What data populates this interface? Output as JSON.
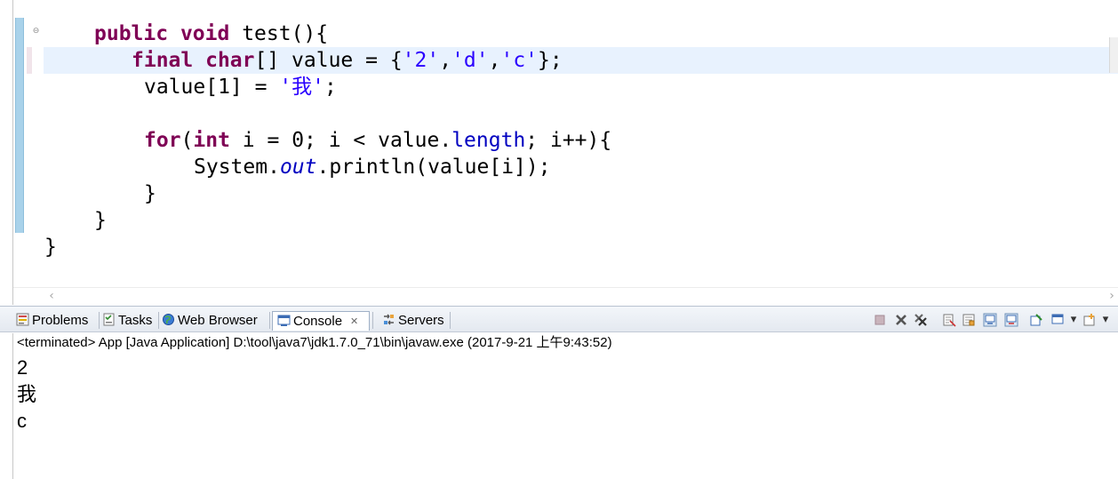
{
  "editor": {
    "code": {
      "line1": {
        "kw_public": "public",
        "kw_void": "void",
        "rest": " test(){"
      },
      "line2": {
        "kw_final": "final",
        "kw_char": "char",
        "mid": "[] value = {",
        "s1": "'2'",
        "c1": ",",
        "s2": "'d'",
        "c2": ",",
        "s3": "'c'",
        "end": "};"
      },
      "line3": {
        "start": "value[1] = ",
        "s1": "'我'",
        "end": ";"
      },
      "line4": {
        "kw_for": "for",
        "p1": "(",
        "kw_int": "int",
        "mid": " i = 0; i < value.",
        "field": "length",
        "end": "; i++){"
      },
      "line5": {
        "start": "System.",
        "static_field": "out",
        "end": ".println(value[i]);"
      },
      "line6": {
        "text": "}"
      },
      "line7": {
        "text": "}"
      },
      "line8": {
        "text": "}"
      }
    }
  },
  "views": {
    "tabs": [
      {
        "label": "Problems",
        "icon": "problems-icon"
      },
      {
        "label": "Tasks",
        "icon": "tasks-icon"
      },
      {
        "label": "Web Browser",
        "icon": "globe-icon"
      },
      {
        "label": "Console",
        "icon": "console-icon",
        "active": true
      },
      {
        "label": "Servers",
        "icon": "servers-icon"
      }
    ],
    "close_glyph": "✕"
  },
  "console": {
    "header": "<terminated> App [Java Application] D:\\tool\\java7\\jdk1.7.0_71\\bin\\javaw.exe (2017-9-21 上午9:43:52)",
    "output": [
      "2",
      "我",
      "c"
    ]
  },
  "colors": {
    "keyword": "#7f0055",
    "string": "#2a00ff",
    "field": "#0000c0",
    "current_line": "#e8f2fe",
    "ruler": "#a9d2ea"
  }
}
